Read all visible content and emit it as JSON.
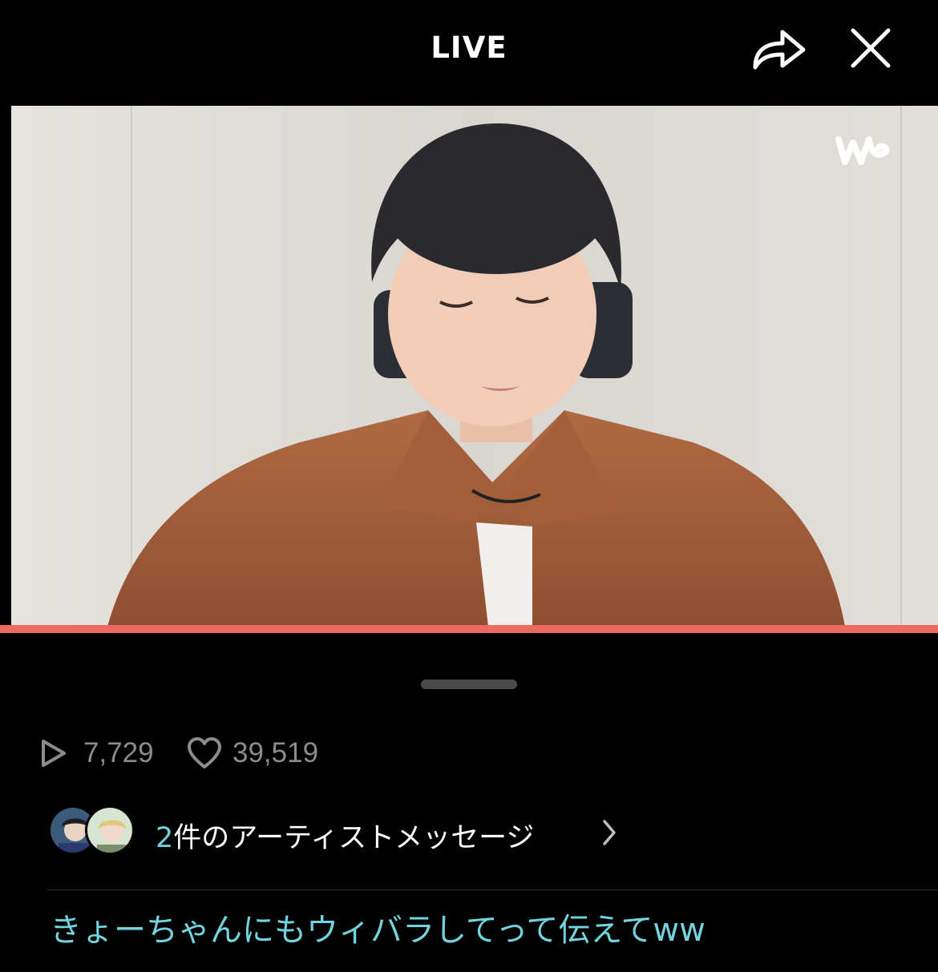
{
  "header": {
    "title": "LIVE",
    "share_icon": "share-arrow-icon",
    "close_icon": "close-x-icon"
  },
  "video": {
    "watermark_icon": "weverse-logo-icon",
    "progress": 1.0,
    "progress_color": "#ee6a5f"
  },
  "stats": {
    "play_icon": "play-count-icon",
    "plays": "7,729",
    "like_icon": "heart-icon",
    "likes": "39,519"
  },
  "artist_messages": {
    "count": "2",
    "label": "件のアーティストメッセージ",
    "chevron_icon": "chevron-right-icon",
    "accent_color": "#6fd3dc"
  },
  "comments": [
    {
      "text": "きょーちゃんにもウィバラしてって伝えてww",
      "color": "#72d4de"
    }
  ]
}
